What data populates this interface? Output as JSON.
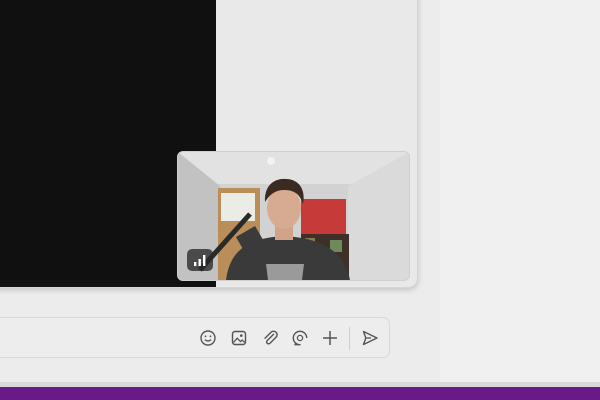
{
  "call": {
    "remote_video": "blank",
    "self_view": {
      "signal_icon": "signal-strength-icon"
    }
  },
  "composer": {
    "placeholder": "",
    "tools": [
      {
        "name": "emoji-icon"
      },
      {
        "name": "image-icon"
      },
      {
        "name": "attach-icon"
      },
      {
        "name": "sticker-icon"
      },
      {
        "name": "plus-icon"
      },
      {
        "name": "send-icon"
      }
    ]
  },
  "colors": {
    "background": "#ececec",
    "remote_video": "#101010",
    "accent_bar": "#6a1a86",
    "icon": "#555555"
  }
}
